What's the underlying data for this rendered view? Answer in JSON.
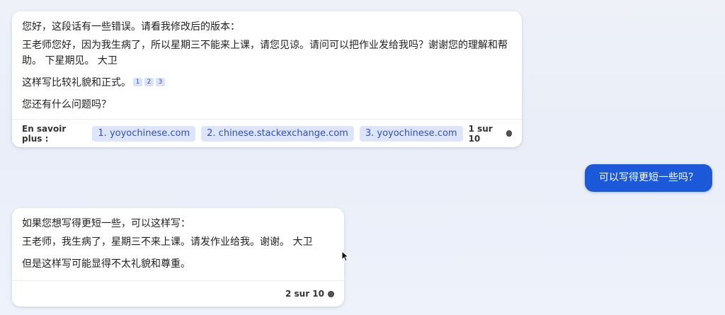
{
  "messages": {
    "bot1": {
      "lines": [
        "您好，这段话有一些错误。请看我修改后的版本：",
        "王老师您好，因为我生病了，所以星期三不能来上课，请您见谅。请问可以把作业发给我吗？谢谢您的理解和帮助。 下星期见。 大卫",
        "这样写比较礼貌和正式。",
        "您还有什么问题吗？"
      ],
      "citations": [
        "1",
        "2",
        "3"
      ],
      "learn_more_label": "En savoir plus :",
      "links": [
        "1. yoyochinese.com",
        "2. chinese.stackexchange.com",
        "3. yoyochinese.com"
      ],
      "pager": "1 sur 10"
    },
    "user": {
      "text": "可以写得更短一些吗？"
    },
    "bot2": {
      "lines": [
        "如果您想写得更短一些，可以这样写：",
        "王老师，我生病了，星期三不来上课。请发作业给我。谢谢。 大卫",
        "但是这样写可能显得不太礼貌和尊重。"
      ],
      "pager": "2 sur 10"
    }
  },
  "colors": {
    "user_bubble": "#1b59d9",
    "link_chip_bg": "#dde5fb",
    "link_chip_text": "#2f4fc2"
  }
}
